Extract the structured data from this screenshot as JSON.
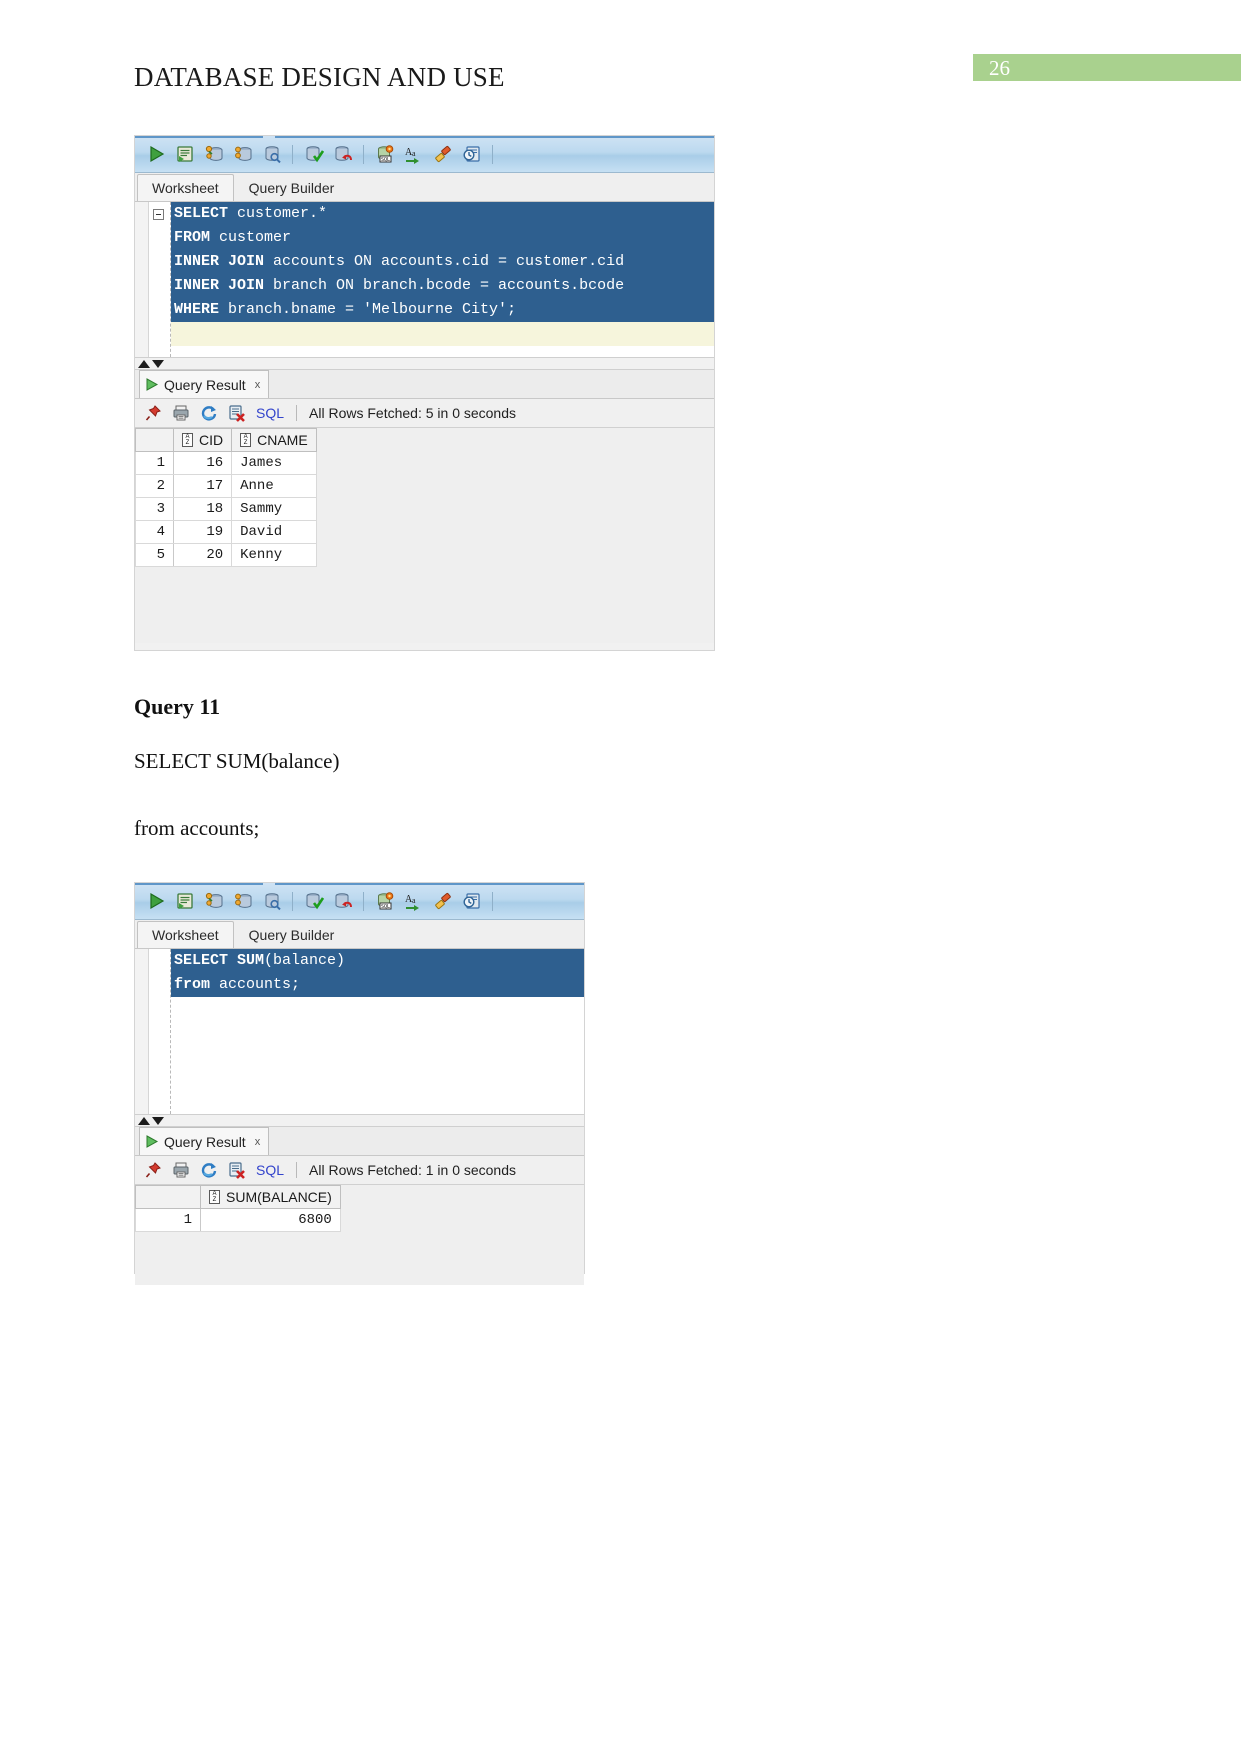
{
  "page": {
    "document_title": "DATABASE DESIGN AND USE",
    "page_number": "26"
  },
  "windows": [
    {
      "id": "sqldev-query10",
      "toolbar_icons": [
        "run-statement-icon",
        "run-script-icon",
        "explain-plan-icon",
        "autotrace-icon",
        "sql-history-icon",
        "commit-icon",
        "rollback-icon",
        "unshared-sql-worksheet-icon",
        "format-sql-icon",
        "clear-icon",
        "query-history-icon"
      ],
      "tabs": [
        {
          "label": "Worksheet",
          "active": true
        },
        {
          "label": "Query Builder",
          "active": false
        }
      ],
      "code_lines": [
        {
          "text": "SELECT customer.*",
          "bold_prefix": "SELECT",
          "selected": true
        },
        {
          "text": "FROM customer",
          "bold_prefix": "FROM",
          "selected": true
        },
        {
          "text": "INNER JOIN accounts ON accounts.cid = customer.cid",
          "bold_prefix": "INNER JOIN",
          "selected": true
        },
        {
          "text": "INNER JOIN branch ON branch.bcode = accounts.bcode",
          "bold_prefix": "INNER JOIN",
          "selected": true
        },
        {
          "text": "WHERE branch.bname = 'Melbourne City';",
          "bold_prefix": "WHERE",
          "selected": true
        }
      ],
      "result_tab": {
        "label": "Query Result",
        "close": "x"
      },
      "result_toolbar": {
        "icons": [
          "pin-icon",
          "print-icon",
          "refresh-icon",
          "cancel-icon"
        ],
        "sql_label": "SQL",
        "fetch_status": "All Rows Fetched: 5 in 0 seconds"
      },
      "grid": {
        "columns": [
          "CID",
          "CNAME"
        ],
        "rows": [
          {
            "n": "1",
            "cells": [
              "16",
              "James"
            ]
          },
          {
            "n": "2",
            "cells": [
              "17",
              "Anne"
            ]
          },
          {
            "n": "3",
            "cells": [
              "18",
              "Sammy"
            ]
          },
          {
            "n": "4",
            "cells": [
              "19",
              "David"
            ]
          },
          {
            "n": "5",
            "cells": [
              "20",
              "Kenny"
            ]
          }
        ]
      }
    },
    {
      "id": "sqldev-query11",
      "toolbar_icons": [
        "run-statement-icon",
        "run-script-icon",
        "explain-plan-icon",
        "autotrace-icon",
        "sql-history-icon",
        "commit-icon",
        "rollback-icon",
        "unshared-sql-worksheet-icon",
        "format-sql-icon",
        "clear-icon",
        "query-history-icon"
      ],
      "tabs": [
        {
          "label": "Worksheet",
          "active": true
        },
        {
          "label": "Query Builder",
          "active": false
        }
      ],
      "code_lines": [
        {
          "text": "SELECT SUM(balance)",
          "bold_prefix": "SELECT SUM",
          "selected": true
        },
        {
          "text": "from accounts;",
          "bold_prefix": "from",
          "selected": true
        }
      ],
      "result_tab": {
        "label": "Query Result",
        "close": "x"
      },
      "result_toolbar": {
        "icons": [
          "pin-icon",
          "print-icon",
          "refresh-icon",
          "cancel-icon"
        ],
        "sql_label": "SQL",
        "fetch_status": "All Rows Fetched: 1 in 0 seconds"
      },
      "grid": {
        "columns": [
          "SUM(BALANCE)"
        ],
        "rows": [
          {
            "n": "1",
            "cells": [
              "6800"
            ]
          }
        ]
      }
    }
  ],
  "body": {
    "query_heading": "Query 11",
    "query_line_1": "SELECT SUM(balance)",
    "query_line_2": "from accounts;"
  }
}
